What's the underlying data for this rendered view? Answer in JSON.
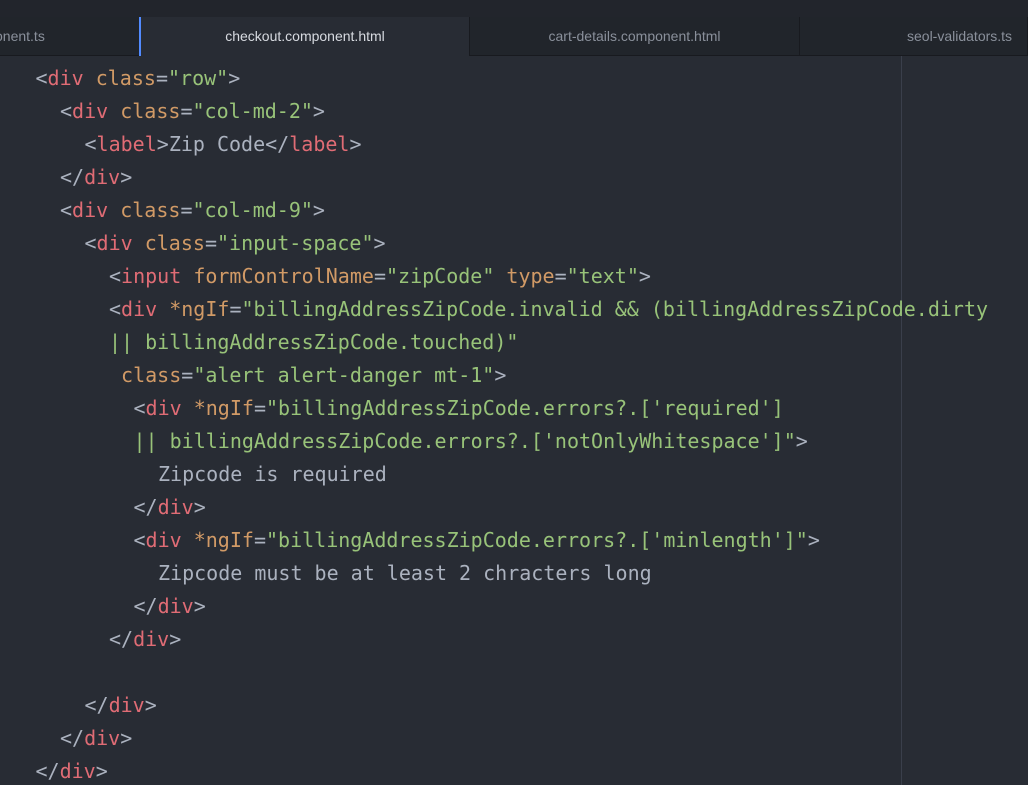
{
  "tabs": [
    {
      "label": "onent.ts",
      "active": false
    },
    {
      "label": "checkout.component.html",
      "active": true
    },
    {
      "label": "cart-details.component.html",
      "active": false
    },
    {
      "label": "seol-validators.ts",
      "active": false
    }
  ],
  "colors": {
    "background": "#282c34",
    "tab_bar": "#21252b",
    "active_tab_indicator": "#528bff",
    "punctuation": "#abb2bf",
    "tag": "#e06c75",
    "attribute": "#d19a66",
    "string": "#98c379",
    "text": "#abb2bf"
  },
  "code_lines": [
    {
      "indent": 1,
      "tokens": [
        [
          "punct",
          "<"
        ],
        [
          "tag",
          "div"
        ],
        [
          "punct",
          " "
        ],
        [
          "attr",
          "class"
        ],
        [
          "punct",
          "="
        ],
        [
          "str",
          "\"row\""
        ],
        [
          "punct",
          ">"
        ]
      ]
    },
    {
      "indent": 2,
      "tokens": [
        [
          "punct",
          "<"
        ],
        [
          "tag",
          "div"
        ],
        [
          "punct",
          " "
        ],
        [
          "attr",
          "class"
        ],
        [
          "punct",
          "="
        ],
        [
          "str",
          "\"col-md-2\""
        ],
        [
          "punct",
          ">"
        ]
      ]
    },
    {
      "indent": 3,
      "tokens": [
        [
          "punct",
          "<"
        ],
        [
          "tag",
          "label"
        ],
        [
          "punct",
          ">"
        ],
        [
          "text",
          "Zip Code"
        ],
        [
          "punct",
          "</"
        ],
        [
          "tag",
          "label"
        ],
        [
          "punct",
          ">"
        ]
      ]
    },
    {
      "indent": 2,
      "tokens": [
        [
          "punct",
          "</"
        ],
        [
          "tag",
          "div"
        ],
        [
          "punct",
          ">"
        ]
      ]
    },
    {
      "indent": 2,
      "tokens": [
        [
          "punct",
          "<"
        ],
        [
          "tag",
          "div"
        ],
        [
          "punct",
          " "
        ],
        [
          "attr",
          "class"
        ],
        [
          "punct",
          "="
        ],
        [
          "str",
          "\"col-md-9\""
        ],
        [
          "punct",
          ">"
        ]
      ]
    },
    {
      "indent": 3,
      "tokens": [
        [
          "punct",
          "<"
        ],
        [
          "tag",
          "div"
        ],
        [
          "punct",
          " "
        ],
        [
          "attr",
          "class"
        ],
        [
          "punct",
          "="
        ],
        [
          "str",
          "\"input-space\""
        ],
        [
          "punct",
          ">"
        ]
      ]
    },
    {
      "indent": 4,
      "tokens": [
        [
          "punct",
          "<"
        ],
        [
          "tag",
          "input"
        ],
        [
          "punct",
          " "
        ],
        [
          "attr",
          "formControlName"
        ],
        [
          "punct",
          "="
        ],
        [
          "str",
          "\"zipCode\""
        ],
        [
          "punct",
          " "
        ],
        [
          "attr",
          "type"
        ],
        [
          "punct",
          "="
        ],
        [
          "str",
          "\"text\""
        ],
        [
          "punct",
          ">"
        ]
      ]
    },
    {
      "indent": 4,
      "tokens": [
        [
          "punct",
          "<"
        ],
        [
          "tag",
          "div"
        ],
        [
          "punct",
          " "
        ],
        [
          "attr",
          "*ngIf"
        ],
        [
          "punct",
          "="
        ],
        [
          "str",
          "\"billingAddressZipCode.invalid && (billingAddressZipCode.dirty"
        ]
      ]
    },
    {
      "indent": 4,
      "tokens": [
        [
          "str",
          "|| billingAddressZipCode.touched)\""
        ]
      ]
    },
    {
      "indent": 4,
      "tokens": [
        [
          "punct",
          " "
        ],
        [
          "attr",
          "class"
        ],
        [
          "punct",
          "="
        ],
        [
          "str",
          "\"alert alert-danger mt-1\""
        ],
        [
          "punct",
          ">"
        ]
      ]
    },
    {
      "indent": 5,
      "tokens": [
        [
          "punct",
          "<"
        ],
        [
          "tag",
          "div"
        ],
        [
          "punct",
          " "
        ],
        [
          "attr",
          "*ngIf"
        ],
        [
          "punct",
          "="
        ],
        [
          "str",
          "\"billingAddressZipCode.errors?.['required']"
        ]
      ]
    },
    {
      "indent": 5,
      "tokens": [
        [
          "str",
          "|| billingAddressZipCode.errors?.['notOnlyWhitespace']\""
        ],
        [
          "punct",
          ">"
        ]
      ]
    },
    {
      "indent": 6,
      "tokens": [
        [
          "text",
          "Zipcode is required"
        ]
      ]
    },
    {
      "indent": 5,
      "tokens": [
        [
          "punct",
          "</"
        ],
        [
          "tag",
          "div"
        ],
        [
          "punct",
          ">"
        ]
      ]
    },
    {
      "indent": 5,
      "tokens": [
        [
          "punct",
          "<"
        ],
        [
          "tag",
          "div"
        ],
        [
          "punct",
          " "
        ],
        [
          "attr",
          "*ngIf"
        ],
        [
          "punct",
          "="
        ],
        [
          "str",
          "\"billingAddressZipCode.errors?.['minlength']\""
        ],
        [
          "punct",
          ">"
        ]
      ]
    },
    {
      "indent": 6,
      "tokens": [
        [
          "text",
          "Zipcode must be at least 2 chracters long"
        ]
      ]
    },
    {
      "indent": 5,
      "tokens": [
        [
          "punct",
          "</"
        ],
        [
          "tag",
          "div"
        ],
        [
          "punct",
          ">"
        ]
      ]
    },
    {
      "indent": 4,
      "tokens": [
        [
          "punct",
          "</"
        ],
        [
          "tag",
          "div"
        ],
        [
          "punct",
          ">"
        ]
      ]
    },
    {
      "indent": 0,
      "tokens": []
    },
    {
      "indent": 3,
      "tokens": [
        [
          "punct",
          "</"
        ],
        [
          "tag",
          "div"
        ],
        [
          "punct",
          ">"
        ]
      ]
    },
    {
      "indent": 2,
      "tokens": [
        [
          "punct",
          "</"
        ],
        [
          "tag",
          "div"
        ],
        [
          "punct",
          ">"
        ]
      ]
    },
    {
      "indent": 1,
      "tokens": [
        [
          "punct",
          "</"
        ],
        [
          "tag",
          "div"
        ],
        [
          "punct",
          ">"
        ]
      ]
    }
  ]
}
